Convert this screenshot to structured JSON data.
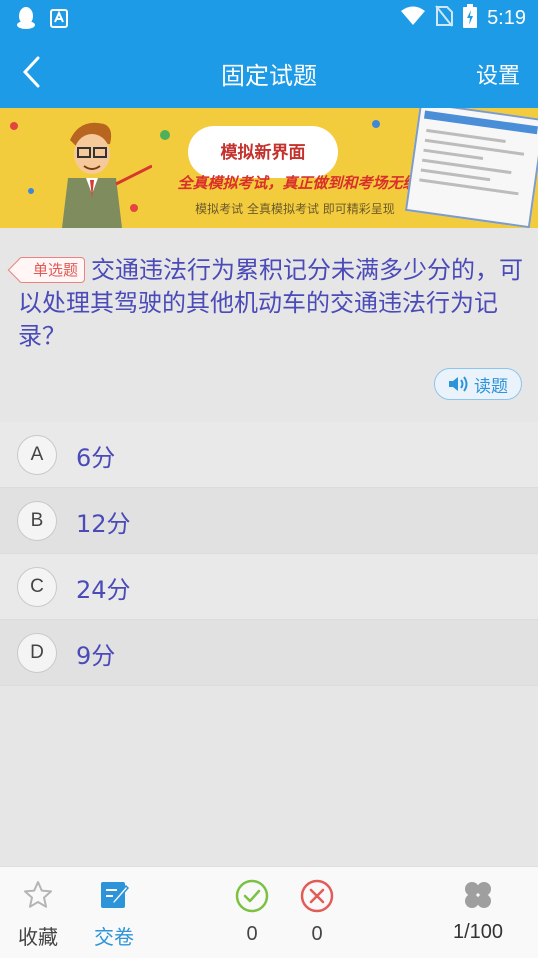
{
  "status_bar": {
    "time": "5:19",
    "icons": [
      "qq-icon",
      "store-icon",
      "wifi-icon",
      "no-sim-icon",
      "battery-charging-icon"
    ]
  },
  "app_bar": {
    "title": "固定试题",
    "settings_label": "设置",
    "back_icon": "chevron-left-icon"
  },
  "banner": {
    "heading": "模拟新界面",
    "slogan": "全真模拟考试，真正做到和考场无缝对接。",
    "subtitle": "模拟考试 全真模拟考试 即可精彩呈现"
  },
  "question": {
    "type_tag": "单选题",
    "text": "交通违法行为累积记分未满多少分的，可以处理其驾驶的其他机动车的交通违法行为记录？",
    "read_button_label": "读题"
  },
  "options": [
    {
      "letter": "A",
      "text": "6分"
    },
    {
      "letter": "B",
      "text": "12分"
    },
    {
      "letter": "C",
      "text": "24分"
    },
    {
      "letter": "D",
      "text": "9分"
    }
  ],
  "bottom_bar": {
    "favorite_label": "收藏",
    "submit_label": "交卷",
    "correct_count": "0",
    "wrong_count": "0",
    "progress": "1/100"
  },
  "colors": {
    "primary": "#1e9be6",
    "question_text": "#4a4bb8",
    "tag": "#e05a56",
    "correct": "#7bc142",
    "wrong": "#e25b57"
  }
}
